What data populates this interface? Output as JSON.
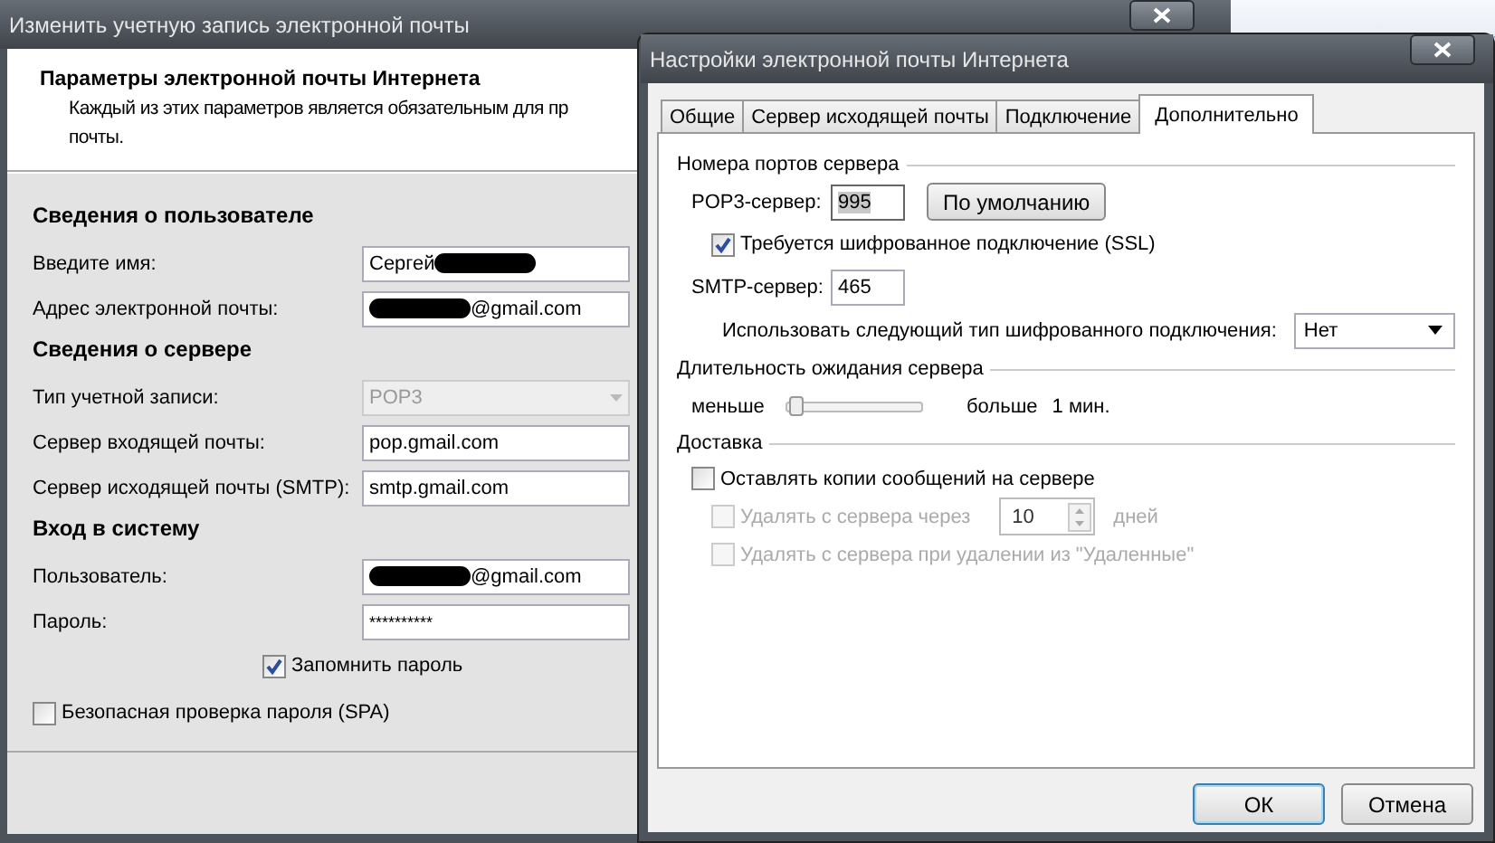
{
  "back_window": {
    "title": "Изменить учетную запись электронной почты",
    "heading": "Параметры электронной почты Интернета",
    "description_lines": [
      "Каждый из этих параметров является обязательным для пр",
      "почты."
    ],
    "sections": [
      {
        "title": "Сведения о пользователе",
        "rows": [
          {
            "label": "Введите имя:",
            "kind": "text",
            "value": "Сергей",
            "redacted_after": true
          },
          {
            "label": "Адрес электронной почты:",
            "kind": "text",
            "value": "@gmail.com",
            "redacted_before": true
          }
        ]
      },
      {
        "title": "Сведения о сервере",
        "rows": [
          {
            "label": "Тип учетной записи:",
            "kind": "select",
            "value": "POP3",
            "disabled": true
          },
          {
            "label": "Сервер входящей почты:",
            "kind": "text",
            "value": "pop.gmail.com"
          },
          {
            "label": "Сервер исходящей почты (SMTP):",
            "kind": "text",
            "value": "smtp.gmail.com"
          }
        ]
      },
      {
        "title": "Вход в систему",
        "rows": [
          {
            "label": "Пользователь:",
            "kind": "text",
            "value": "@gmail.com",
            "redacted_before": true
          },
          {
            "label": "Пароль:",
            "kind": "password",
            "value": "**********"
          }
        ]
      }
    ],
    "remember_password": {
      "label": "Запомнить пароль",
      "checked": true
    },
    "spa": {
      "label": "Безопасная проверка пароля (SPA)",
      "checked": false
    }
  },
  "dialog": {
    "title": "Настройки электронной почты Интернета",
    "tabs": [
      {
        "label": "Общие",
        "selected": false
      },
      {
        "label": "Сервер исходящей почты",
        "selected": false
      },
      {
        "label": "Подключение",
        "selected": false
      },
      {
        "label": "Дополнительно",
        "selected": true
      }
    ],
    "ports": {
      "title": "Номера портов сервера",
      "pop3_label": "POP3-сервер:",
      "pop3_value": "995",
      "default_button": "По умолчанию",
      "ssl": {
        "label": "Требуется шифрованное подключение (SSL)",
        "checked": true
      },
      "smtp_label": "SMTP-сервер:",
      "smtp_value": "465",
      "encryption_label": "Использовать следующий тип шифрованного подключения:",
      "encryption_value": "Нет"
    },
    "timeout": {
      "title": "Длительность ожидания сервера",
      "less": "меньше",
      "level": 0.02,
      "more": "больше",
      "reading": "1 мин."
    },
    "delivery": {
      "title": "Доставка",
      "leave_copies": {
        "label": "Оставлять копии сообщений на сервере",
        "checked": false,
        "disabled": false
      },
      "delete_after": {
        "label": "Удалять с сервера через",
        "checked": false,
        "disabled": true,
        "value": "10",
        "unit": "дней"
      },
      "delete_on_remove": {
        "label": "Удалять с сервера при удалении из \"Удаленные\"",
        "checked": false,
        "disabled": true
      }
    },
    "buttons": [
      {
        "label": "ОК",
        "default": true
      },
      {
        "label": "Отмена",
        "default": false
      }
    ]
  }
}
